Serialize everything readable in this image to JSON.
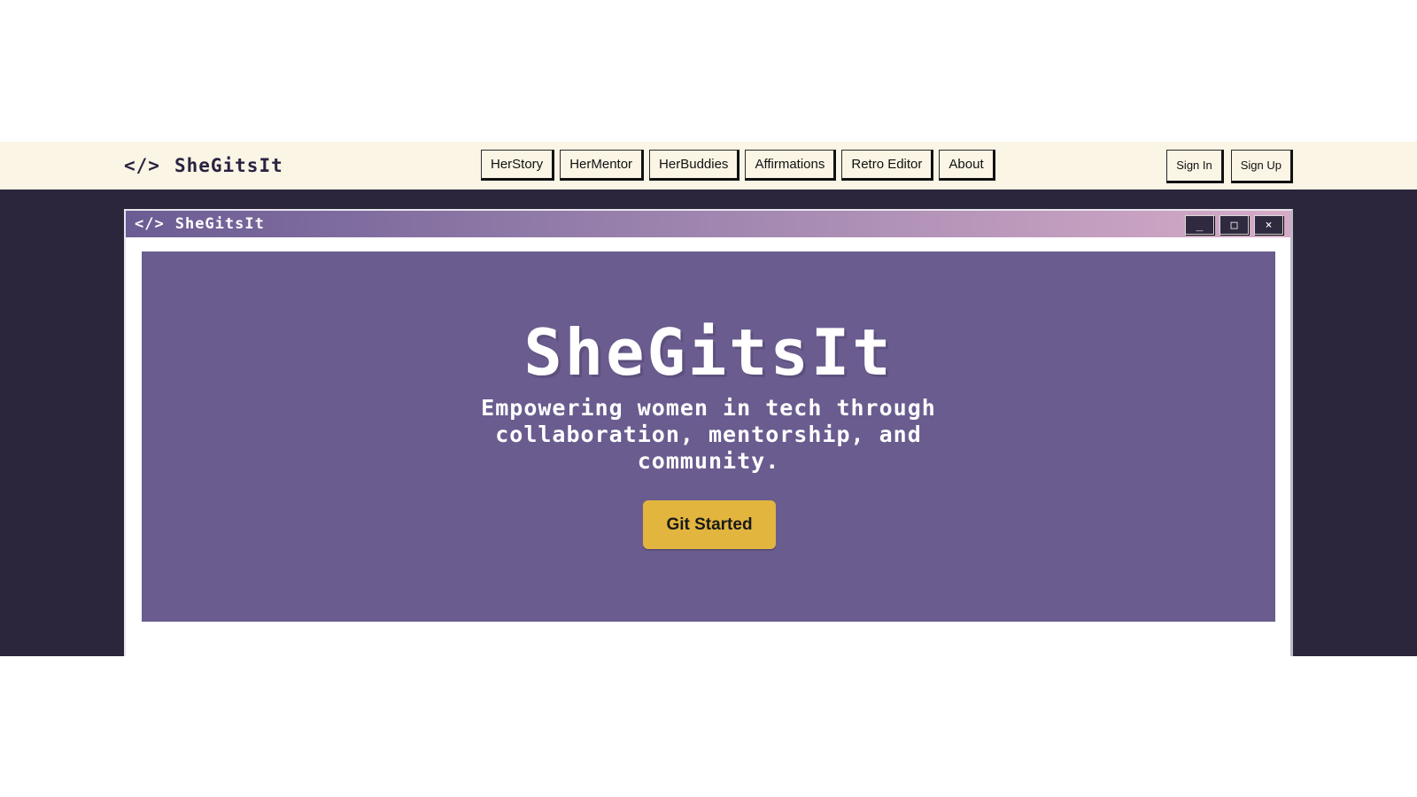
{
  "nav": {
    "brand": {
      "icon": "</>",
      "name": "SheGitsIt"
    },
    "links": [
      {
        "label": "HerStory"
      },
      {
        "label": "HerMentor"
      },
      {
        "label": "HerBuddies"
      },
      {
        "label": "Affirmations"
      },
      {
        "label": "Retro Editor"
      },
      {
        "label": "About"
      }
    ],
    "auth": {
      "sign_in": "Sign In",
      "sign_up": "Sign Up"
    }
  },
  "window": {
    "title_icon": "</>",
    "title": "SheGitsIt",
    "controls": {
      "minimize": "_",
      "maximize": "□",
      "close": "×"
    }
  },
  "hero": {
    "title": "SheGitsIt",
    "subtitle": "Empowering women in tech through collaboration, mentorship, and community.",
    "cta_label": "Git Started"
  },
  "colors": {
    "navbar_bg": "#fbf5e6",
    "stage_bg": "#2c263d",
    "hero_bg": "#6a5c8f",
    "cta_bg": "#e2b53e",
    "titlebar_gradient_start": "#6b5c94",
    "titlebar_gradient_end": "#d6abc8"
  }
}
